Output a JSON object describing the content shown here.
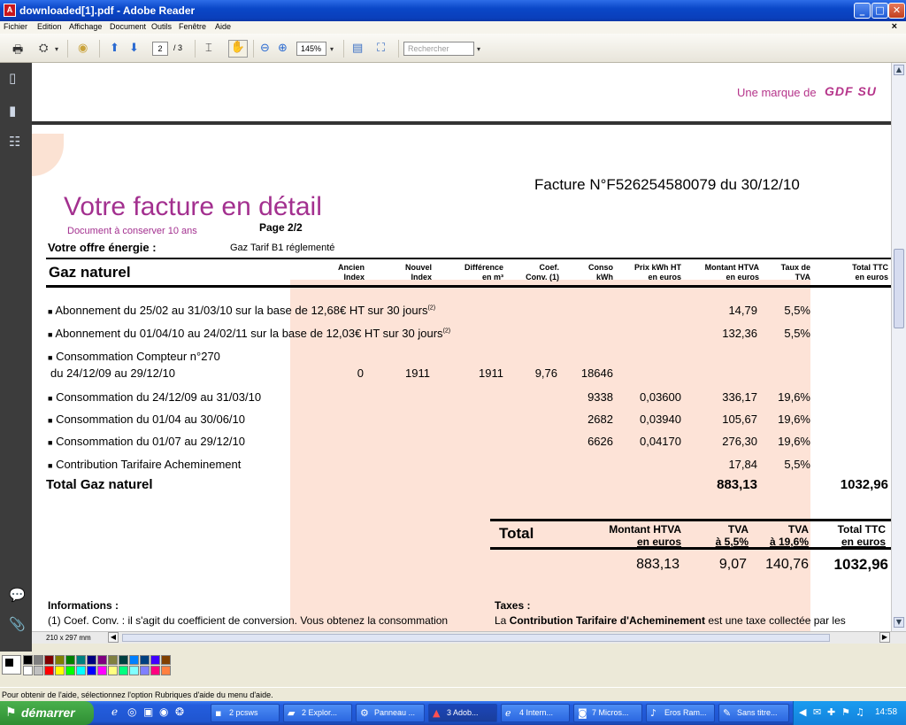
{
  "window": {
    "title": "downloaded[1].pdf - Adobe Reader"
  },
  "menu": [
    "Fichier",
    "Edition",
    "Affichage",
    "Document",
    "Outils",
    "Fenêtre",
    "Aide"
  ],
  "toolbar": {
    "page_current": "2",
    "page_total": "/ 3",
    "zoom": "145%",
    "search_placeholder": "Rechercher"
  },
  "document": {
    "brand": "Une marque de",
    "brand_logo": "GDF SU",
    "invoice_ref": "Facture N°F526254580079 du 30/12/10",
    "title": "Votre facture en détail",
    "subtitle": "Document à conserver 10 ans",
    "page": "Page 2/2",
    "offer_label": "Votre offre énergie :",
    "offer_value": "Gaz Tarif B1 réglementé",
    "section": "Gaz naturel",
    "columns": [
      {
        "l1": "Ancien",
        "l2": "Index"
      },
      {
        "l1": "Nouvel",
        "l2": "Index"
      },
      {
        "l1": "Différence",
        "l2": "en m³"
      },
      {
        "l1": "Coef.",
        "l2": "Conv. (1)"
      },
      {
        "l1": "Conso",
        "l2": "kWh"
      },
      {
        "l1": "Prix kWh HT",
        "l2": "en euros"
      },
      {
        "l1": "Montant HTVA",
        "l2": "en euros"
      },
      {
        "l1": "Taux de",
        "l2": "TVA"
      },
      {
        "l1": "Total TTC",
        "l2": "en euros"
      }
    ],
    "rows": [
      {
        "label": "Abonnement du 25/02 au 31/03/10 sur la base de 12,68€ HT sur 30 jours",
        "sup": "(2)",
        "montant": "14,79",
        "tva": "5,5%"
      },
      {
        "label": "Abonnement du 01/04/10 au 24/02/11 sur la base de 12,03€ HT sur 30 jours",
        "sup": "(2)",
        "montant": "132,36",
        "tva": "5,5%"
      },
      {
        "label": "Consommation Compteur n°270",
        "label2": "du 24/12/09 au 29/12/10",
        "ancien": "0",
        "nouvel": "1911",
        "diff": "1911",
        "coef": "9,76",
        "conso": "18646"
      },
      {
        "label": "Consommation du 24/12/09 au 31/03/10",
        "conso": "9338",
        "prix": "0,03600",
        "montant": "336,17",
        "tva": "19,6%"
      },
      {
        "label": "Consommation du 01/04 au 30/06/10",
        "conso": "2682",
        "prix": "0,03940",
        "montant": "105,67",
        "tva": "19,6%"
      },
      {
        "label": "Consommation du 01/07 au 29/12/10",
        "conso": "6626",
        "prix": "0,04170",
        "montant": "276,30",
        "tva": "19,6%"
      },
      {
        "label": "Contribution Tarifaire Acheminement",
        "montant": "17,84",
        "tva": "5,5%"
      }
    ],
    "total_gaz": {
      "label": "Total Gaz naturel",
      "montant": "883,13",
      "ttc": "1032,96"
    },
    "summary": {
      "label": "Total",
      "h1a": "Montant HTVA",
      "h1b": "en euros",
      "h2a": "TVA",
      "h2b": "à 5,5%",
      "h3a": "TVA",
      "h3b": "à 19,6%",
      "h4a": "Total TTC",
      "h4b": "en euros",
      "v1": "883,13",
      "v2": "9,07",
      "v3": "140,76",
      "v4": "1032,96"
    },
    "info_title": "Informations :",
    "info_text": "(1) Coef. Conv. : il s'agit du coefficient de conversion. Vous obtenez la consommation",
    "taxes_title": "Taxes :",
    "taxes_pre": "La ",
    "taxes_bold": "Contribution Tarifaire d'Acheminement",
    "taxes_post": " est une taxe collectée par les",
    "page_size": "210 x 297 mm"
  },
  "help_text": "Pour obtenir de l'aide, sélectionnez l'option Rubriques d'aide du menu d'aide.",
  "taskbar": {
    "start": "démarrer",
    "buttons": [
      "2 pcsws",
      "2 Explor...",
      "Panneau ...",
      "3 Adob...",
      "4 Intern...",
      "7 Micros...",
      "Eros Ram...",
      "Sans titre..."
    ],
    "clock": "14:58"
  },
  "colors": {
    "accent": "#b5348a",
    "pink_band": "#fde3d7",
    "title_purple": "#a3308f"
  }
}
